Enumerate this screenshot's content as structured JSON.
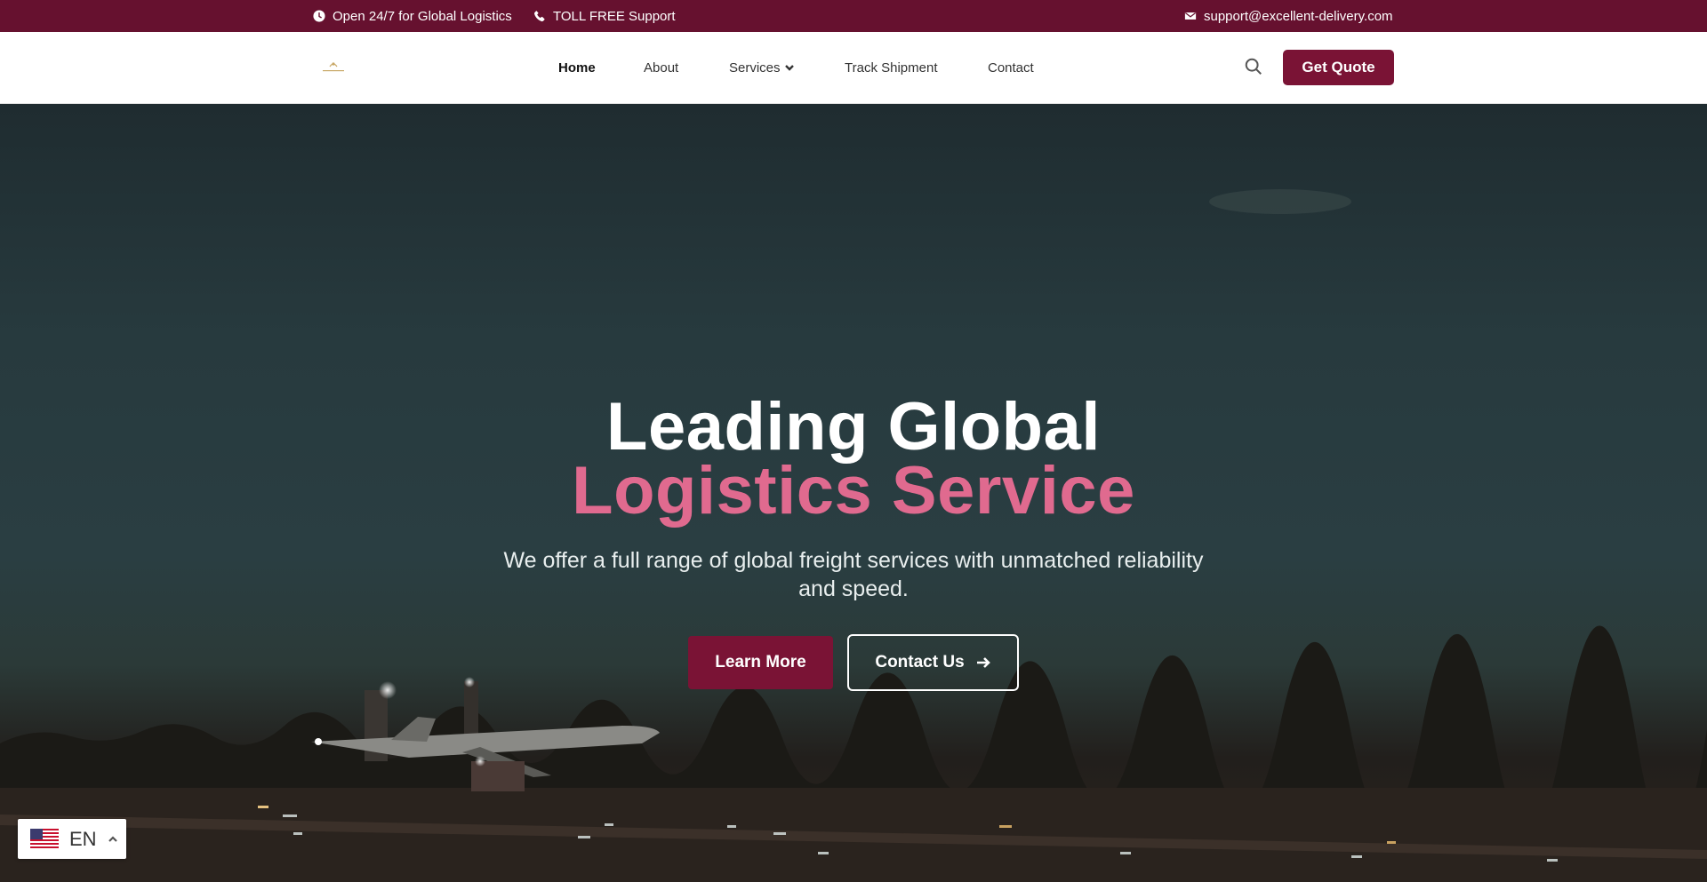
{
  "topbar": {
    "hours": "Open 24/7 for Global Logistics",
    "phone": "TOLL FREE Support",
    "email": "support@excellent-delivery.com"
  },
  "header": {
    "nav": [
      {
        "label": "Home",
        "active": true
      },
      {
        "label": "About"
      },
      {
        "label": "Services",
        "has_dropdown": true
      },
      {
        "label": "Track Shipment"
      },
      {
        "label": "Contact"
      }
    ],
    "quote_label": "Get Quote"
  },
  "hero": {
    "title_line1": "Leading Global",
    "title_line2": "Logistics Service",
    "subtitle": "We offer a full range of global freight services with unmatched reliability and speed.",
    "learn_more": "Learn More",
    "contact_us": "Contact Us"
  },
  "language": {
    "code": "EN",
    "flag": "us-flag-icon"
  },
  "colors": {
    "brand": "#66112f",
    "button": "#7a1335",
    "accent_text": "#e06a8f"
  }
}
